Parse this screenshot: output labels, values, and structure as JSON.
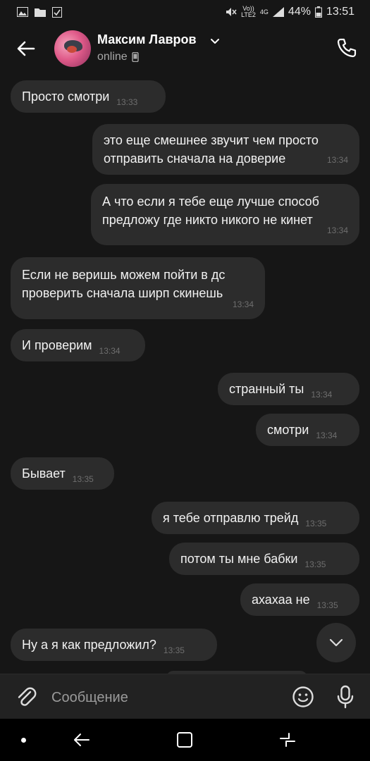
{
  "status_bar": {
    "volte": "Vo))",
    "lte": "LTE2",
    "net": "4G",
    "battery": "44%",
    "time": "13:51"
  },
  "header": {
    "contact_name": "Максим Лавров",
    "status": "online"
  },
  "messages": [
    {
      "side": "in",
      "text": "Просто смотри",
      "time": "13:33"
    },
    {
      "side": "out",
      "text": "это еще смешнее звучит чем просто отправить сначала на доверие",
      "time": "13:34"
    },
    {
      "side": "out",
      "text": "А что если я тебе еще лучше способ предложу где никто никого не кинет",
      "time": "13:34"
    },
    {
      "side": "in",
      "text": "Если не веришь можем пойти в дс проверить сначала ширп скинешь",
      "time": "13:34"
    },
    {
      "side": "in",
      "text": "И проверим",
      "time": "13:34"
    },
    {
      "side": "out",
      "text": "странный ты",
      "time": "13:34"
    },
    {
      "side": "out",
      "text": "смотри",
      "time": "13:34"
    },
    {
      "side": "in",
      "text": "Бывает",
      "time": "13:35"
    },
    {
      "side": "out",
      "text": "я тебе отправлю трейд",
      "time": "13:35"
    },
    {
      "side": "out",
      "text": "потом ты мне бабки",
      "time": "13:35"
    },
    {
      "side": "out",
      "text": "ахахаа не",
      "time": "13:35"
    },
    {
      "side": "in",
      "text": "Ну а я как предложил?",
      "time": "13:35"
    }
  ],
  "composer": {
    "placeholder": "Сообщение"
  }
}
